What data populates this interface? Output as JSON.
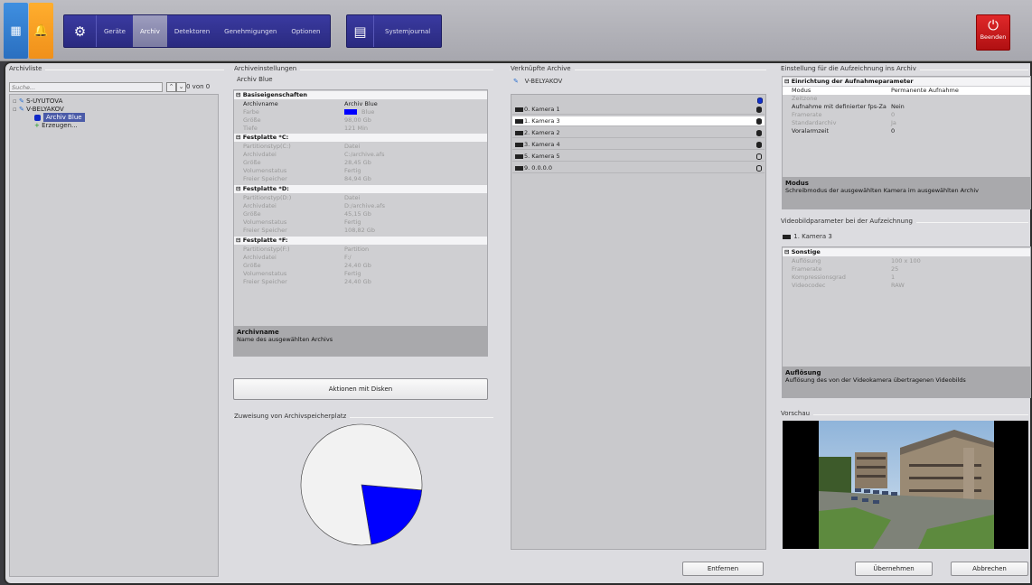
{
  "toolbar": {
    "menu": [
      "Geräte",
      "Archiv",
      "Detektoren",
      "Genehmigungen",
      "Optionen"
    ],
    "journal": "Systemjournal",
    "exit": "Beenden"
  },
  "archive_list": {
    "title": "Archivliste",
    "search_placeholder": "Suche...",
    "up_icon": "chevron-up-icon",
    "down_icon": "chevron-down-icon",
    "count": "0 von 0",
    "tree": [
      "S-UYUTOVA",
      "V-BELYAKOV",
      "Archiv Blue",
      "Erzeugen..."
    ]
  },
  "archive_settings": {
    "title": "Archiveinstellungen",
    "archive_name": "Archiv Blue",
    "categories": [
      "Basiseigenschaften",
      "Festplatte *C:",
      "Festplatte *D:",
      "Festplatte *F:"
    ],
    "base": [
      {
        "k": "Archivname",
        "v": "Archiv Blue"
      },
      {
        "k": "Farbe",
        "v": "Blue"
      },
      {
        "k": "Größe",
        "v": "98,00 Gb"
      },
      {
        "k": "Tiefe",
        "v": "121 Min"
      }
    ],
    "disk_c": [
      {
        "k": "Partitionstyp(C:)",
        "v": "Datei"
      },
      {
        "k": "Archivdatei",
        "v": "C:/archive.afs"
      },
      {
        "k": "Größe",
        "v": "28,45 Gb"
      },
      {
        "k": "Volumenstatus",
        "v": "Fertig"
      },
      {
        "k": "Freier Speicher",
        "v": "84,94 Gb"
      }
    ],
    "disk_d": [
      {
        "k": "Partitionstyp(D:)",
        "v": "Datei"
      },
      {
        "k": "Archivdatei",
        "v": "D:/archive.afs"
      },
      {
        "k": "Größe",
        "v": "45,15 Gb"
      },
      {
        "k": "Volumenstatus",
        "v": "Fertig"
      },
      {
        "k": "Freier Speicher",
        "v": "108,82 Gb"
      }
    ],
    "disk_f": [
      {
        "k": "Partitionstyp(F:)",
        "v": "Partition"
      },
      {
        "k": "Archivdatei",
        "v": "F:/"
      },
      {
        "k": "Größe",
        "v": "24,40 Gb"
      },
      {
        "k": "Volumenstatus",
        "v": "Fertig"
      },
      {
        "k": "Freier Speicher",
        "v": "24,40 Gb"
      }
    ],
    "desc_title": "Archivname",
    "desc_text": "Name des ausgewählten Archivs",
    "disk_actions": "Aktionen mit Disken",
    "allocation_title": "Zuweisung von Archivspeicherplatz",
    "color_swatch": "#0000ff"
  },
  "chart_data": {
    "type": "pie",
    "slices": [
      {
        "label": "Archiv Blue",
        "value": 0.21,
        "color": "#0000ff"
      },
      {
        "label": "",
        "value": 0.79,
        "color": "#f2f2f2"
      }
    ]
  },
  "linked": {
    "title": "Verknüpfte Archive",
    "server": "V-BELYAKOV",
    "cameras": [
      "0. Kamera 1",
      "1. Kamera 3",
      "2. Kamera 2",
      "3. Kamera 4",
      "5. Kamera 5",
      "9. 0.0.0.0"
    ],
    "remove": "Entfernen"
  },
  "recording": {
    "title": "Einstellung für die Aufzeichnung ins Archiv",
    "category": "Einrichtung der Aufnahmeparameter",
    "rows": [
      {
        "k": "Modus",
        "v": "Permanente Aufnahme"
      },
      {
        "k": "Zeitzone",
        "v": ""
      },
      {
        "k": "Aufnahme mit definierter fps-Za",
        "v": "Nein"
      },
      {
        "k": "Framerate",
        "v": "0"
      },
      {
        "k": "Standardarchiv",
        "v": "Ja"
      },
      {
        "k": "Voralarmzeit",
        "v": "0"
      }
    ],
    "desc_title": "Modus",
    "desc_text": "Schreibmodus der ausgewählten Kamera im ausgewählten Archiv"
  },
  "video": {
    "title": "Videobildparameter bei der Aufzeichnung",
    "camera": "1. Kamera 3",
    "category": "Sonstige",
    "rows": [
      {
        "k": "Auflösung",
        "v": "100 x 100"
      },
      {
        "k": "Framerate",
        "v": "25"
      },
      {
        "k": "Kompressionsgrad",
        "v": "1"
      },
      {
        "k": "Videocodec",
        "v": "RAW"
      }
    ],
    "desc_title": "Auflösung",
    "desc_text": "Auflösung des von der Videokamera übertragenen Videobilds"
  },
  "preview": {
    "title": "Vorschau"
  },
  "footer": {
    "apply": "Übernehmen",
    "cancel": "Abbrechen"
  }
}
